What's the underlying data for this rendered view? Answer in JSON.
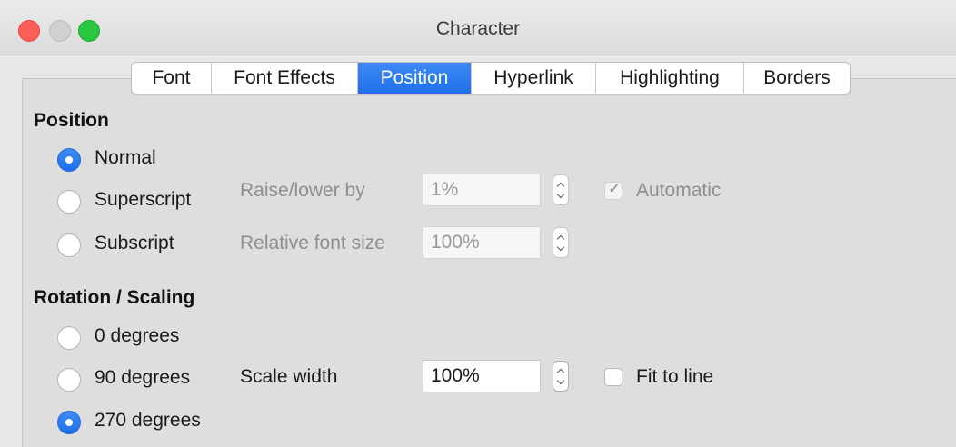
{
  "window": {
    "title": "Character"
  },
  "tabs": [
    {
      "label": "Font",
      "active": false
    },
    {
      "label": "Font Effects",
      "active": false
    },
    {
      "label": "Position",
      "active": true
    },
    {
      "label": "Hyperlink",
      "active": false
    },
    {
      "label": "Highlighting",
      "active": false
    },
    {
      "label": "Borders",
      "active": false
    }
  ],
  "position": {
    "heading": "Position",
    "options": [
      {
        "label": "Normal",
        "selected": true
      },
      {
        "label": "Superscript",
        "selected": false
      },
      {
        "label": "Subscript",
        "selected": false
      }
    ],
    "raise_lower": {
      "label": "Raise/lower by",
      "value": "1%",
      "enabled": false
    },
    "relative_size": {
      "label": "Relative font size",
      "value": "100%",
      "enabled": false
    },
    "automatic": {
      "label": "Automatic",
      "checked": true,
      "enabled": false
    }
  },
  "rotation": {
    "heading": "Rotation / Scaling",
    "options": [
      {
        "label": "0 degrees",
        "selected": false
      },
      {
        "label": "90 degrees",
        "selected": false
      },
      {
        "label": "270 degrees",
        "selected": true
      }
    ],
    "scale_width": {
      "label": "Scale width",
      "value": "100%"
    },
    "fit_to_line": {
      "label": "Fit to line",
      "checked": false
    }
  },
  "colors": {
    "accent": "#1f6fe8",
    "close": "#fc5f57",
    "maximize": "#2ac640"
  }
}
